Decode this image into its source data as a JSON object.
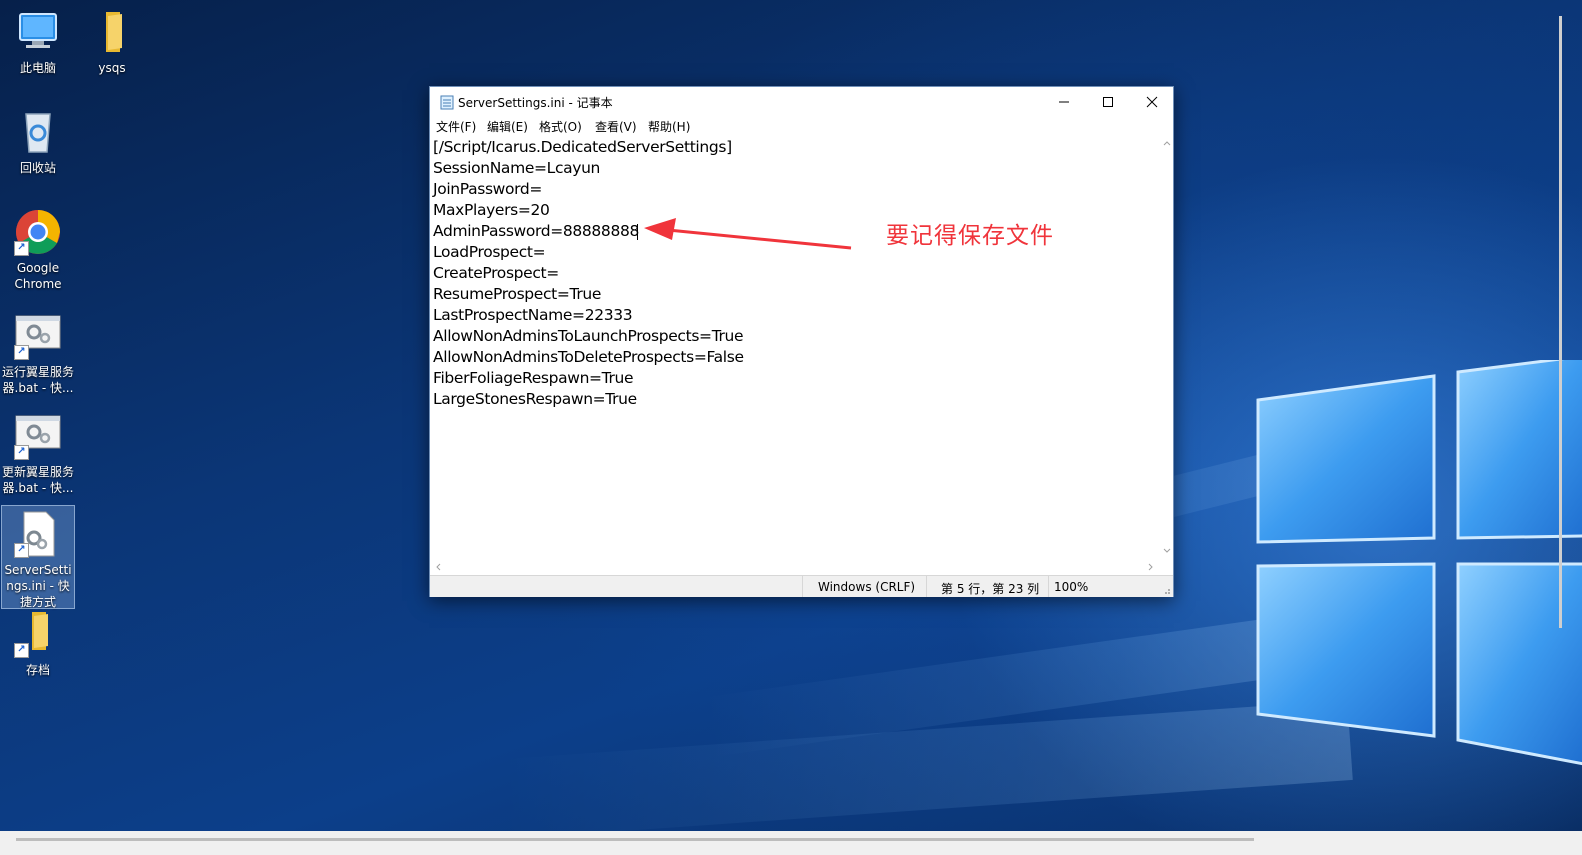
{
  "desktop": {
    "icons": [
      {
        "label": "此电脑"
      },
      {
        "label": "ysqs"
      },
      {
        "label": "回收站"
      },
      {
        "label": "Google Chrome"
      },
      {
        "label": "运行翼星服务器.bat - 快..."
      },
      {
        "label": "更新翼星服务器.bat - 快..."
      },
      {
        "label": "ServerSettings.ini - 快捷方式"
      },
      {
        "label": "存档"
      }
    ]
  },
  "notepad": {
    "title": "ServerSettings.ini - 记事本",
    "menu": [
      "文件(F)",
      "编辑(E)",
      "格式(O)",
      "查看(V)",
      "帮助(H)"
    ],
    "lines": [
      "[/Script/Icarus.DedicatedServerSettings]",
      "SessionName=Lcayun",
      "JoinPassword=",
      "MaxPlayers=20",
      "AdminPassword=88888888",
      "LoadProspect=",
      "CreateProspect=",
      "ResumeProspect=True",
      "LastProspectName=22333",
      "AllowNonAdminsToLaunchProspects=True",
      "AllowNonAdminsToDeleteProspects=False",
      "FiberFoliageRespawn=True",
      "LargeStonesRespawn=True"
    ],
    "status": {
      "encoding": "Windows (CRLF)",
      "position": "第 5 行，第 23 列",
      "zoom": "100%"
    }
  },
  "annotation": {
    "text": "要记得保存文件",
    "color": "#f0343b"
  }
}
